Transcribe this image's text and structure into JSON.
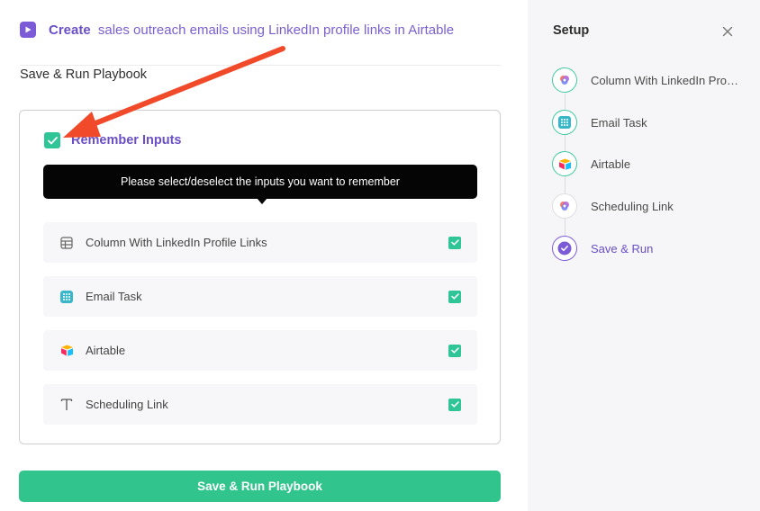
{
  "header": {
    "create_word": "Create",
    "description": "sales outreach emails using LinkedIn profile links in Airtable"
  },
  "section_title": "Save & Run Playbook",
  "remember": {
    "label": "Remember Inputs",
    "checked": true,
    "tooltip": "Please select/deselect the inputs you want to remember"
  },
  "inputs": [
    {
      "label": "Column With LinkedIn Profile Links",
      "icon": "table-icon",
      "checked": true
    },
    {
      "label": "Email Task",
      "icon": "grid-dots-icon",
      "checked": true
    },
    {
      "label": "Airtable",
      "icon": "airtable-icon",
      "checked": true
    },
    {
      "label": "Scheduling Link",
      "icon": "text-icon",
      "checked": true
    }
  ],
  "save_button": "Save & Run Playbook",
  "setup": {
    "title": "Setup",
    "steps": [
      {
        "label": "Column With LinkedIn Profile Links",
        "icon": "app-logo-icon",
        "status": "done"
      },
      {
        "label": "Email Task",
        "icon": "grid-dots-icon",
        "status": "done"
      },
      {
        "label": "Airtable",
        "icon": "airtable-icon",
        "status": "done"
      },
      {
        "label": "Scheduling Link",
        "icon": "app-logo-icon",
        "status": "pending"
      },
      {
        "label": "Save & Run",
        "icon": "check-icon",
        "status": "active"
      }
    ]
  },
  "colors": {
    "accent_purple": "#6a4fc6",
    "success_green": "#32c48d",
    "annotation_arrow": "#f04a2a"
  }
}
